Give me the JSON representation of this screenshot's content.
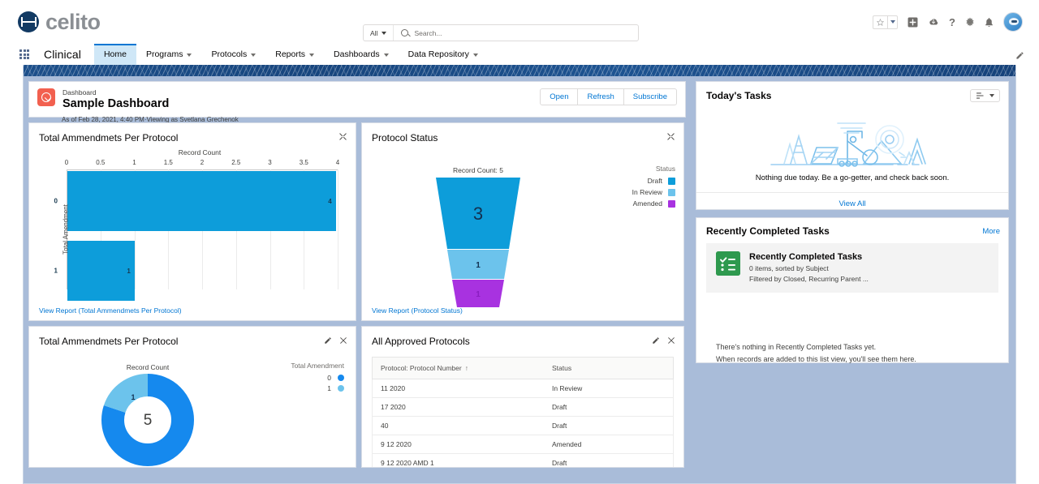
{
  "header": {
    "brand": "celito",
    "search": {
      "scope": "All",
      "placeholder": "Search...",
      "value": ""
    },
    "icons": [
      "favorites-star-icon",
      "favorites-caret-icon",
      "global-actions-icon",
      "cloud-icon",
      "help-icon",
      "setup-gear-icon",
      "notifications-bell-icon",
      "user-avatar"
    ]
  },
  "nav": {
    "app_name": "Clinical",
    "items": [
      {
        "label": "Home",
        "has_menu": false,
        "active": true
      },
      {
        "label": "Programs",
        "has_menu": true,
        "active": false
      },
      {
        "label": "Protocols",
        "has_menu": true,
        "active": false
      },
      {
        "label": "Reports",
        "has_menu": true,
        "active": false
      },
      {
        "label": "Dashboards",
        "has_menu": true,
        "active": false
      },
      {
        "label": "Data Repository",
        "has_menu": true,
        "active": false
      }
    ],
    "edit_icon": "pencil-icon"
  },
  "dashboard": {
    "kicker": "Dashboard",
    "title": "Sample Dashboard",
    "meta": "As of Feb 28, 2021, 4:40 PM·Viewing as Svetlana Grechenok",
    "buttons": [
      "Open",
      "Refresh",
      "Subscribe"
    ]
  },
  "widgets": {
    "bar": {
      "title": "Total Ammendmets Per Protocol",
      "view_report": "View Report (Total Ammendmets Per Protocol)",
      "expand_icon": "expand-icon"
    },
    "funnel": {
      "title": "Protocol Status",
      "caption": "Record Count: 5",
      "view_report": "View Report (Protocol Status)",
      "expand_icon": "expand-icon"
    },
    "donut": {
      "title": "Total Ammendmets Per Protocol",
      "caption": "Record Count",
      "edit_icon": "pencil-icon",
      "close_icon": "close-icon"
    },
    "table": {
      "title": "All Approved Protocols",
      "edit_icon": "pencil-icon",
      "close_icon": "close-icon",
      "sort_indicator": "↑",
      "columns": [
        "Protocol: Protocol Number",
        "Status"
      ],
      "rows": [
        [
          "11 2020",
          "In Review"
        ],
        [
          "17 2020",
          "Draft"
        ],
        [
          "40",
          "Draft"
        ],
        [
          "9 12 2020",
          "Amended"
        ],
        [
          "9 12 2020 AMD 1",
          "Draft"
        ]
      ]
    }
  },
  "right": {
    "tasks": {
      "title": "Today's Tasks",
      "control_icon": "list-view-controls-icon",
      "caret_icon": "chevron-down-icon",
      "empty_message": "Nothing due today. Be a go-getter, and check back soon.",
      "view_all": "View All"
    },
    "completed": {
      "title": "Recently Completed Tasks",
      "more": "More",
      "card_title": "Recently Completed Tasks",
      "card_sub1": "0 items, sorted by Subject",
      "card_sub2": "Filtered by Closed, Recurring Parent ...",
      "empty_line1": "There's nothing in Recently Completed Tasks yet.",
      "empty_line2": "When records are added to this list view, you'll see them here.",
      "icon": "task-list-icon"
    }
  },
  "colors": {
    "brand_navy": "#123a63",
    "link_blue": "#0176d3",
    "chart_blue": "#0d9dda",
    "chart_light_blue": "#6cc3ec",
    "chart_purple": "#a832e0",
    "dash_backdrop": "#a9bcd9",
    "deco_band": "#17457d",
    "green_icon": "#2e994e",
    "dashboard_icon_red": "#f2604f"
  },
  "chart_data": [
    {
      "type": "bar",
      "orientation": "horizontal",
      "title": "Total Ammendmets Per Protocol",
      "xlabel": "Record Count",
      "ylabel": "Total Amendment",
      "categories": [
        "0",
        "1"
      ],
      "values": [
        4,
        1
      ],
      "xlim": [
        0,
        4
      ],
      "xticks": [
        "0",
        "0.5",
        "1",
        "1.5",
        "2",
        "2.5",
        "3",
        "3.5",
        "4"
      ],
      "grid": true,
      "legend": "none",
      "color": "#0d9dda"
    },
    {
      "type": "funnel",
      "title": "Protocol Status",
      "caption": "Record Count: 5",
      "legend_title": "Status",
      "legend_position": "right",
      "categories": [
        "Draft",
        "In Review",
        "Amended"
      ],
      "values": [
        3,
        1,
        1
      ],
      "colors": [
        "#0d9dda",
        "#6cc3ec",
        "#a832e0"
      ],
      "total": 5
    },
    {
      "type": "pie",
      "variant": "donut",
      "title": "Total Ammendmets Per Protocol",
      "caption": "Record Count",
      "legend_title": "Total Amendment",
      "legend_position": "right",
      "categories": [
        "0",
        "1"
      ],
      "values": [
        4,
        1
      ],
      "colors": [
        "#1589ee",
        "#6cc3ec"
      ],
      "center_label": "5",
      "slice_labels": [
        "",
        "1"
      ]
    }
  ]
}
